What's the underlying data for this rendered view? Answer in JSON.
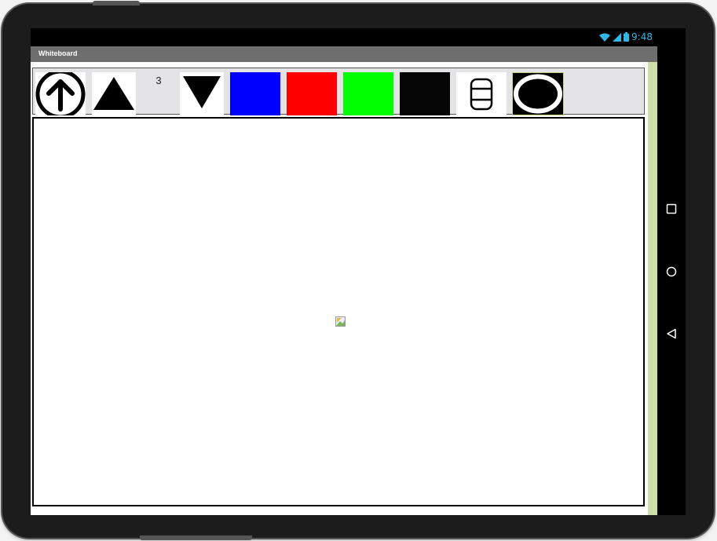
{
  "status_bar": {
    "time": "9:48",
    "icons": [
      "wifi-icon",
      "signal-icon",
      "battery-icon"
    ]
  },
  "app": {
    "title": "Whiteboard"
  },
  "toolbar": {
    "items": [
      {
        "name": "upload-arrow-button",
        "icon": "arrow-up-circle-icon"
      },
      {
        "name": "increase-size-button",
        "icon": "triangle-up-icon"
      },
      {
        "name": "brush-size-label"
      },
      {
        "name": "decrease-size-button",
        "icon": "triangle-down-icon"
      },
      {
        "name": "color-blue-button",
        "color": "#0000ff"
      },
      {
        "name": "color-red-button",
        "color": "#ff0000"
      },
      {
        "name": "color-green-button",
        "color": "#00ff00"
      },
      {
        "name": "color-black-button",
        "color": "#000000"
      },
      {
        "name": "eraser-button",
        "icon": "eraser-icon"
      },
      {
        "name": "circle-tool-button",
        "icon": "circle-icon"
      }
    ],
    "brush_size": "3"
  },
  "canvas": {
    "placeholder_icon": "broken-image-icon"
  },
  "nav_bar": {
    "buttons": [
      "recent-apps-icon",
      "home-icon",
      "back-icon"
    ]
  },
  "colors": {
    "title_bar": "#6e6e6e",
    "status_accent": "#33b5e5",
    "side_stripe": "#d0dcaa",
    "toolbar_bg": "#e4e4e6"
  }
}
